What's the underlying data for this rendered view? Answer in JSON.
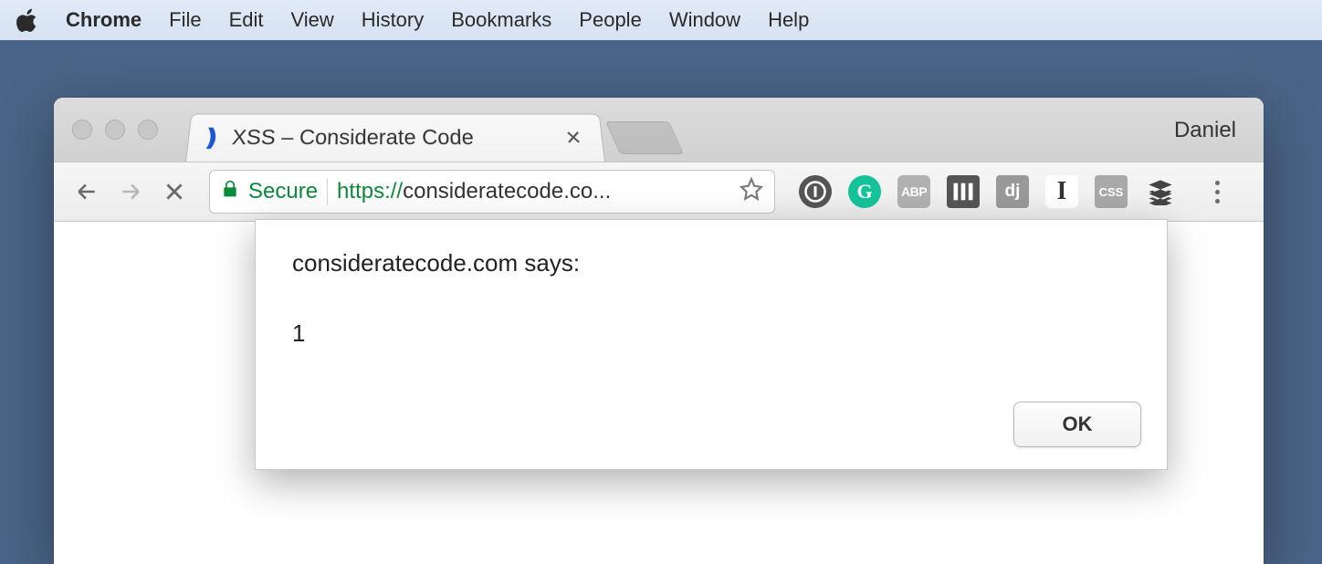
{
  "menubar": {
    "app_name": "Chrome",
    "items": [
      "File",
      "Edit",
      "View",
      "History",
      "Bookmarks",
      "People",
      "Window",
      "Help"
    ]
  },
  "window": {
    "profile_name": "Daniel"
  },
  "tab": {
    "title": "XSS – Considerate Code"
  },
  "omnibox": {
    "secure_label": "Secure",
    "url_protocol": "https://",
    "url_rest": "consideratecode.co..."
  },
  "extensions": {
    "onepass": "①",
    "grammarly": "G",
    "abp": "ABP",
    "dj": "dj",
    "instapaper": "I",
    "css3": "CSS"
  },
  "dialog": {
    "title": "consideratecode.com says:",
    "message": "1",
    "ok_label": "OK"
  }
}
